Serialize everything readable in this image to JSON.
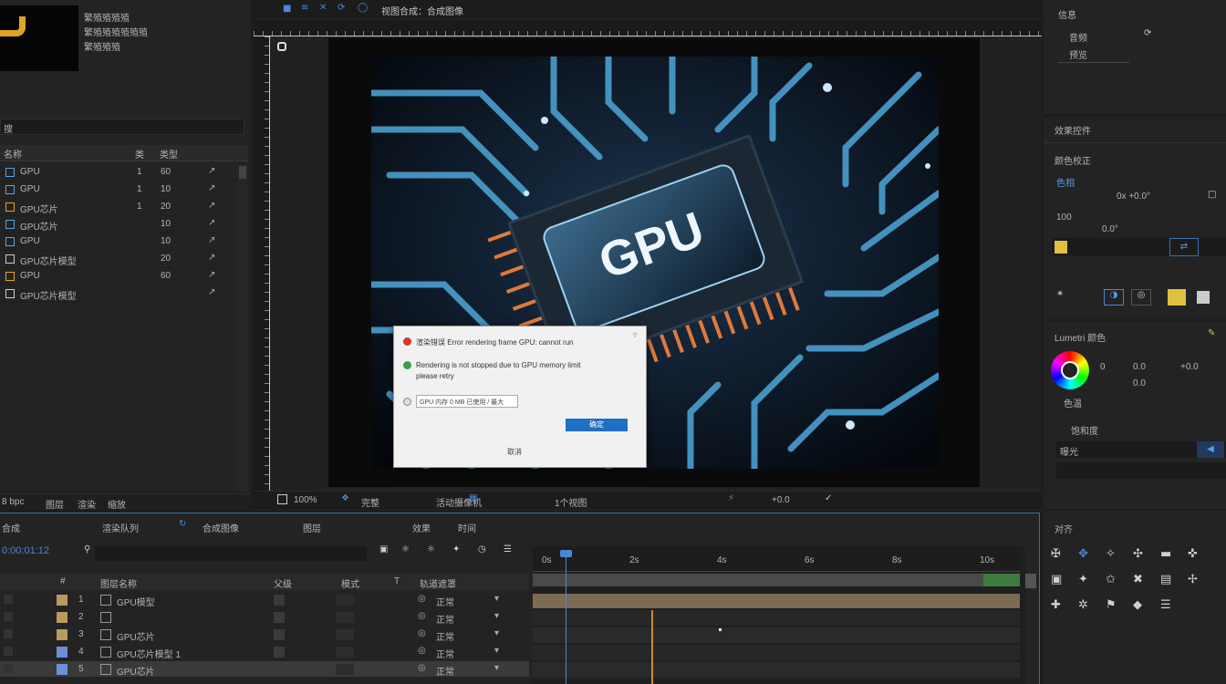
{
  "project": {
    "thumb_info": [
      "繁殖殖殖殖",
      "繁殖殖殖殖殖殖",
      "繁殖殖殖"
    ],
    "search_label": "搜",
    "header": {
      "name": "名称",
      "type": "类",
      "size": "类型"
    },
    "items": [
      {
        "name": "GPU",
        "c1": "1",
        "c2": "60"
      },
      {
        "name": "GPU",
        "c1": "1",
        "c2": "10"
      },
      {
        "name": "GPU芯片",
        "c1": "1",
        "c2": "20"
      },
      {
        "name": "GPU芯片",
        "c1": "",
        "c2": "10"
      },
      {
        "name": "GPU",
        "c1": "",
        "c2": "10"
      },
      {
        "name": "GPU芯片模型",
        "c1": "",
        "c2": "20"
      },
      {
        "name": "GPU",
        "c1": "",
        "c2": "60"
      },
      {
        "name": "GPU芯片模型",
        "c1": "",
        "c2": ""
      }
    ],
    "bottom": [
      "8 bpc",
      "图层",
      "渲染",
      "缩放"
    ]
  },
  "viewer": {
    "title": "视图合成：合成图像",
    "chip_text": "GPU",
    "toolbar_items": [
      "100%",
      "完整",
      "活动摄像机",
      "1个视图",
      "+0.0"
    ]
  },
  "dialog": {
    "line1": "渲染错误 Error rendering frame GPU: cannot run",
    "line2": "Rendering is not stopped due to GPU memory limit",
    "line2b": "please retry",
    "field": "GPU 内存 0 MB 已使用 / 最大",
    "button": "确定",
    "footer": "取消"
  },
  "right_top": {
    "items": [
      "信息",
      "音频",
      "预览"
    ]
  },
  "effects": {
    "title": "效果控件",
    "section": "颜色校正",
    "sub": "色相",
    "value_label": "0x +0.0°",
    "amount": "100",
    "angle": "0.0°"
  },
  "color_panel": {
    "title": "Lumetri 颜色",
    "readouts": [
      "0",
      "0.0",
      "+0.0",
      "0.0"
    ],
    "labels": [
      "色温",
      "饱和度",
      "曝光"
    ]
  },
  "bottom_right": {
    "title": "对齐"
  },
  "timeline": {
    "tabs": [
      "合成",
      "渲染队列",
      "合成图像",
      "图层",
      "效果",
      "时间"
    ],
    "headers": [
      "#",
      "图层名称",
      "父级",
      "模式",
      "T",
      "轨道遮罩"
    ],
    "layers": [
      {
        "num": "1",
        "name": "GPU模型",
        "mode": "正常"
      },
      {
        "num": "2",
        "name": "",
        "mode": "正常"
      },
      {
        "num": "3",
        "name": "GPU芯片",
        "mode": "正常"
      },
      {
        "num": "4",
        "name": "GPU芯片模型 1",
        "mode": "正常"
      },
      {
        "num": "5",
        "name": "GPU芯片",
        "mode": "正常"
      }
    ],
    "ruler": [
      "0s",
      "2s",
      "4s",
      "6s",
      "8s",
      "10s"
    ],
    "current_time": "0:00:01:12"
  }
}
